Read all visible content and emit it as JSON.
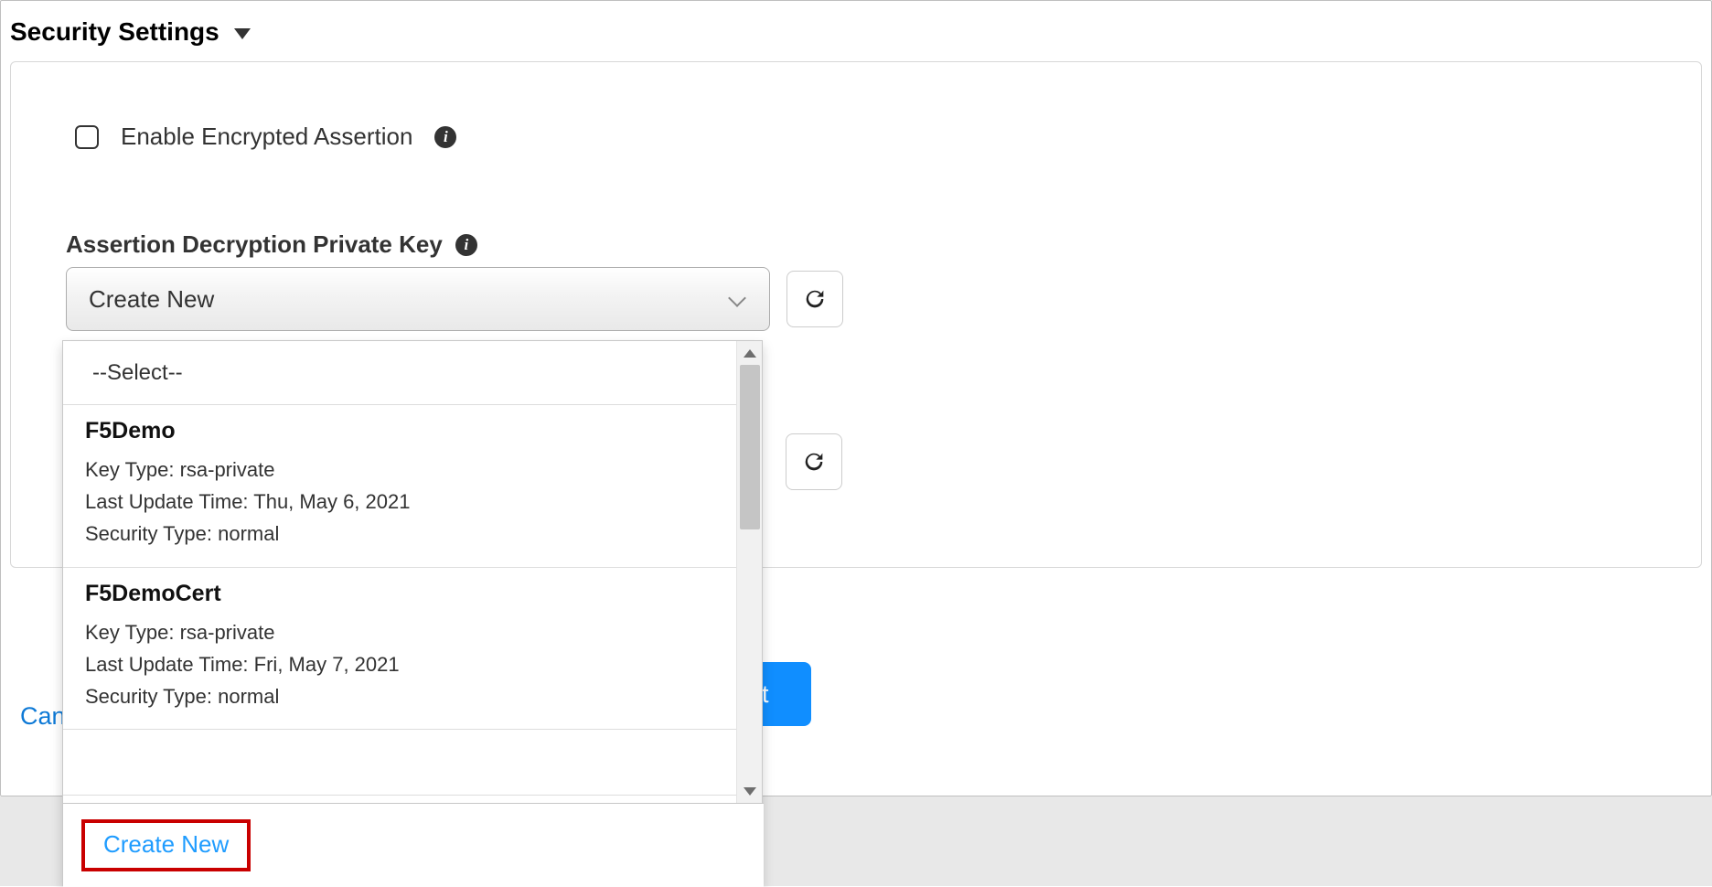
{
  "section": {
    "title": "Security Settings"
  },
  "checkbox": {
    "label": "Enable Encrypted Assertion"
  },
  "field": {
    "label": "Assertion Decryption Private Key",
    "selected": "Create New"
  },
  "dropdown": {
    "placeholder": "--Select--",
    "items": [
      {
        "name": "F5Demo",
        "key_type_label": "Key Type:",
        "key_type": "rsa-private",
        "last_update_label": "Last Update Time:",
        "last_update": "Thu, May 6, 2021",
        "security_type_label": "Security Type:",
        "security_type": "normal"
      },
      {
        "name": "F5DemoCert",
        "key_type_label": "Key Type:",
        "key_type": "rsa-private",
        "last_update_label": "Last Update Time:",
        "last_update": "Fri, May 7, 2021",
        "security_type_label": "Security Type:",
        "security_type": "normal"
      }
    ],
    "create_new": "Create New"
  },
  "footer": {
    "cancel": "Can",
    "next_fragment": "t"
  }
}
